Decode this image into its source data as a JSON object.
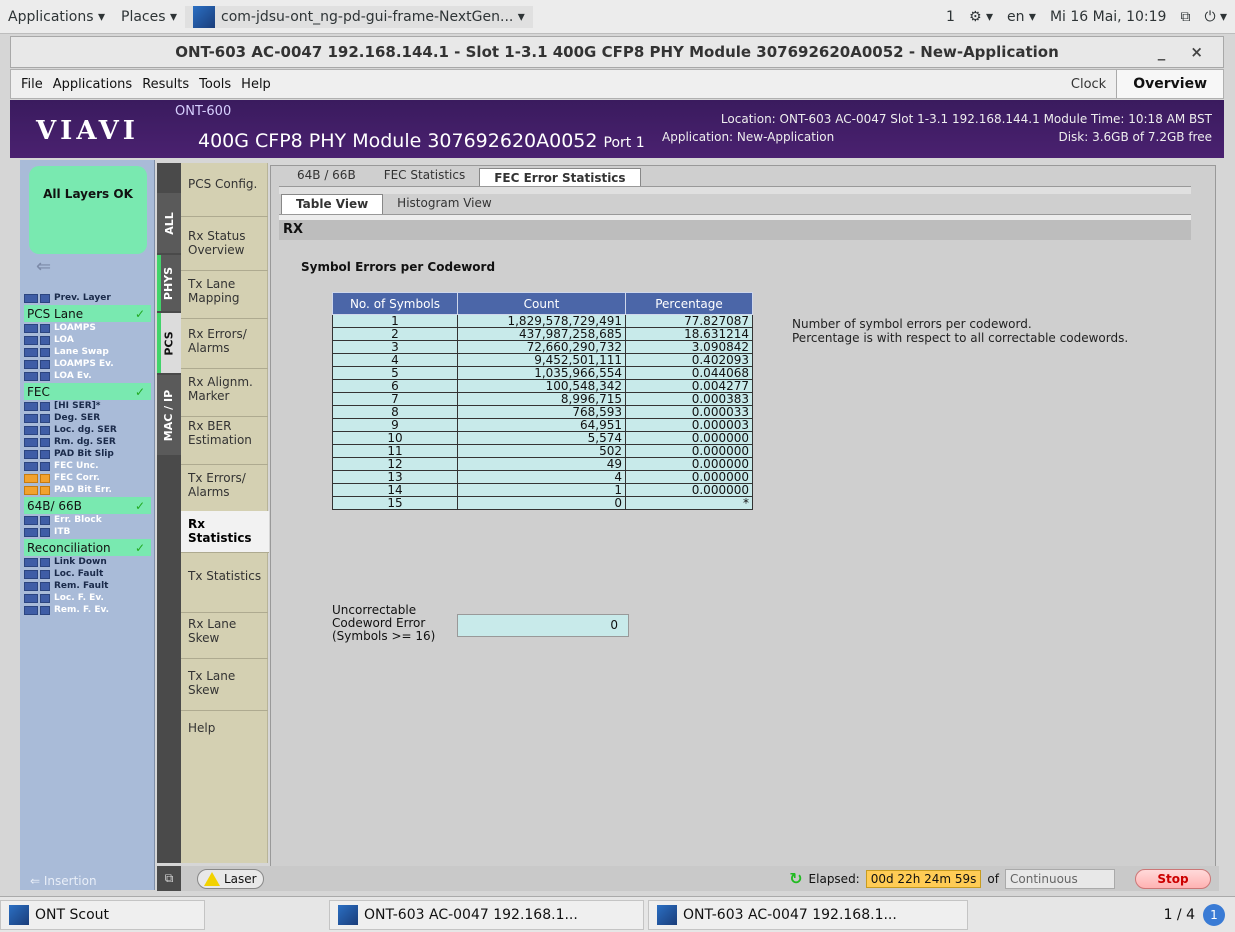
{
  "topbar": {
    "applications": "Applications ▾",
    "places": "Places ▾",
    "app_title": "com-jdsu-ont_ng-pd-gui-frame-NextGen... ▾",
    "workspace": "1",
    "accessibility": "⚙ ▾",
    "lang": "en ▾",
    "datetime": "Mi 16 Mai, 10:19",
    "network": "⧉",
    "power": "⏻ ▾"
  },
  "window": {
    "title": "ONT-603 AC-0047 192.168.144.1 - Slot 1-3.1 400G CFP8 PHY Module 307692620A0052 - New-Application",
    "controls": "_ ×"
  },
  "menubar": {
    "items": [
      "File",
      "Applications",
      "Results",
      "Tools",
      "Help"
    ],
    "clock": "Clock",
    "overview": "Overview"
  },
  "header": {
    "logo": "VIAVI",
    "ont": "ONT-600",
    "module": "400G CFP8 PHY Module 307692620A0052",
    "port": "Port 1",
    "location": "Location: ONT-603 AC-0047 Slot 1-3.1 192.168.144.1 Module Time: 10:18 AM BST",
    "application": "Application: New-Application",
    "disk": "Disk: 3.6GB of 7.2GB free"
  },
  "leftpanel": {
    "all_ok": "All Layers OK",
    "prev_layer": "Prev. Layer",
    "pcs_lane": "PCS Lane",
    "pcs_items": [
      "LOAMPS",
      "LOA",
      "Lane Swap",
      "LOAMPS Ev.",
      "LOA Ev."
    ],
    "fec": "FEC",
    "fec_items": [
      "[HI SER]*",
      "Deg. SER",
      "Loc. dg. SER",
      "Rm. dg. SER",
      "PAD Bit Slip",
      "FEC Unc.",
      "FEC Corr.",
      "PAD Bit Err."
    ],
    "b64": "64B/ 66B",
    "b64_items": [
      "Err. Block",
      "ITB"
    ],
    "recon": "Reconciliation",
    "recon_items": [
      "Link Down",
      "Loc. Fault",
      "Rem. Fault",
      "Loc. F. Ev.",
      "Rem. F. Ev."
    ],
    "insertion": "Insertion"
  },
  "vtabs": [
    "ALL",
    "PHYS",
    "PCS",
    "MAC / IP"
  ],
  "subnav": [
    "PCS Config.",
    "Rx Status Overview",
    "Tx Lane Mapping",
    "Rx Errors/ Alarms",
    "Rx Alignm. Marker",
    "Rx BER Estimation",
    "Tx Errors/ Alarms",
    "Rx Statistics",
    "Tx Statistics",
    "Rx Lane Skew",
    "Tx Lane Skew",
    "Help"
  ],
  "tabs": {
    "top": [
      "64B / 66B",
      "FEC Statistics",
      "FEC Error Statistics"
    ],
    "sub": [
      "Table View",
      "Histogram View"
    ]
  },
  "panel": {
    "rx": "RX",
    "title": "Symbol Errors per Codeword",
    "headers": [
      "No. of Symbols",
      "Count",
      "Percentage"
    ],
    "rows": [
      [
        "1",
        "1,829,578,729,491",
        "77.827087"
      ],
      [
        "2",
        "437,987,258,685",
        "18.631214"
      ],
      [
        "3",
        "72,660,290,732",
        "3.090842"
      ],
      [
        "4",
        "9,452,501,111",
        "0.402093"
      ],
      [
        "5",
        "1,035,966,554",
        "0.044068"
      ],
      [
        "6",
        "100,548,342",
        "0.004277"
      ],
      [
        "7",
        "8,996,715",
        "0.000383"
      ],
      [
        "8",
        "768,593",
        "0.000033"
      ],
      [
        "9",
        "64,951",
        "0.000003"
      ],
      [
        "10",
        "5,574",
        "0.000000"
      ],
      [
        "11",
        "502",
        "0.000000"
      ],
      [
        "12",
        "49",
        "0.000000"
      ],
      [
        "13",
        "4",
        "0.000000"
      ],
      [
        "14",
        "1",
        "0.000000"
      ],
      [
        "15",
        "0",
        "*"
      ]
    ],
    "note1": "Number of symbol errors per codeword.",
    "note2": "Percentage is with respect to all correctable codewords.",
    "uncorr_label1": "Uncorrectable",
    "uncorr_label2": "Codeword Error",
    "uncorr_label3": "(Symbols >= 16)",
    "uncorr_value": "0"
  },
  "statusbar": {
    "laser": "Laser",
    "elapsed_label": "Elapsed:",
    "elapsed": "00d 22h 24m 59s",
    "of": "of",
    "mode": "Continuous",
    "stop": "Stop"
  },
  "taskbar": {
    "scout": "ONT Scout",
    "task1": "ONT-603 AC-0047 192.168.1...",
    "task2": "ONT-603 AC-0047 192.168.1...",
    "pager": "1 / 4",
    "badge": "1"
  }
}
